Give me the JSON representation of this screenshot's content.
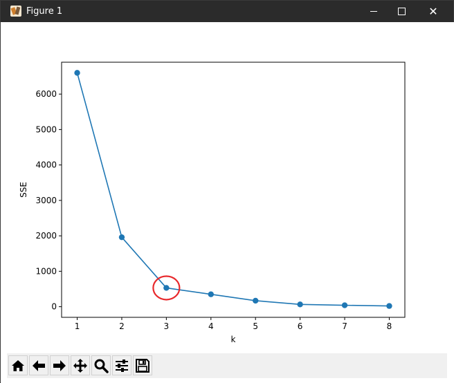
{
  "window": {
    "title": "Figure 1",
    "controls": {
      "minimize": "minimize",
      "maximize": "maximize",
      "close": "✕"
    }
  },
  "toolbar": {
    "buttons": [
      {
        "name": "home",
        "icon": "home-icon"
      },
      {
        "name": "back",
        "icon": "arrow-left-icon"
      },
      {
        "name": "forward",
        "icon": "arrow-right-icon"
      },
      {
        "name": "pan",
        "icon": "move-icon"
      },
      {
        "name": "zoom",
        "icon": "magnifier-icon"
      },
      {
        "name": "configure-subplots",
        "icon": "sliders-icon"
      },
      {
        "name": "save",
        "icon": "floppy-disk-icon"
      }
    ]
  },
  "chart_data": {
    "type": "line",
    "title": "",
    "xlabel": "k",
    "ylabel": "SSE",
    "x": [
      1,
      2,
      3,
      4,
      5,
      6,
      7,
      8
    ],
    "series": [
      {
        "values": [
          6600,
          1960,
          530,
          350,
          170,
          65,
          40,
          20
        ],
        "color": "#1f77b4",
        "marker": "circle"
      }
    ],
    "xticks": [
      "1",
      "2",
      "3",
      "4",
      "5",
      "6",
      "7",
      "8"
    ],
    "yticks": [
      "0",
      "1000",
      "2000",
      "3000",
      "4000",
      "5000",
      "6000"
    ],
    "xlim": [
      0.65,
      8.35
    ],
    "ylim": [
      -300,
      6900
    ],
    "grid": false,
    "annotations": [
      {
        "type": "ellipse",
        "x": 3,
        "y": 530,
        "color": "#e8282b"
      }
    ]
  }
}
